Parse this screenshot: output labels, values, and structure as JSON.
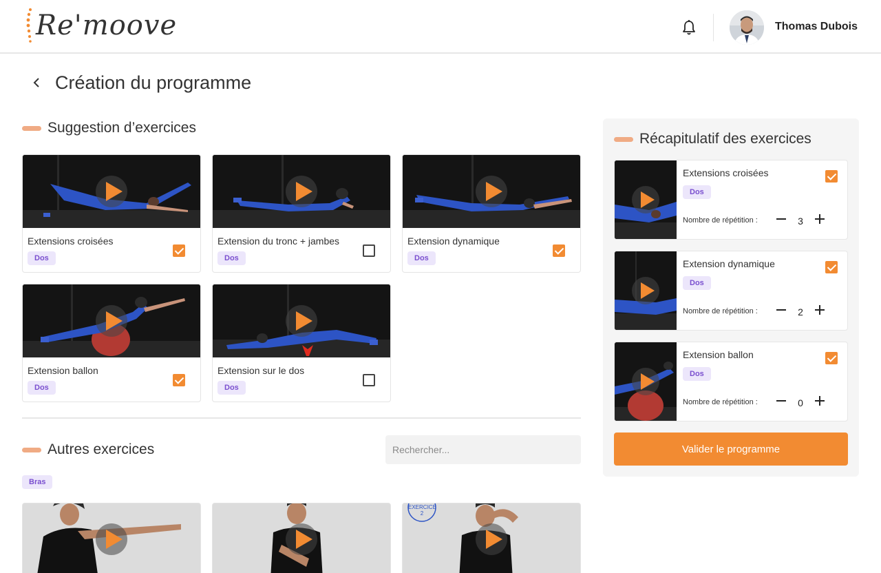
{
  "brand": {
    "logo_text": "Re'moove",
    "accent": "#f28b32",
    "tag_color": "#7a4fcf",
    "tag_bg": "#ece6fb"
  },
  "header": {
    "user_name": "Thomas Dubois",
    "bell_icon": "bell-icon",
    "avatar_icon": "user-avatar"
  },
  "page": {
    "title": "Création du programme",
    "back_icon": "chevron-left-icon"
  },
  "suggestions": {
    "title": "Suggestion d’exercices",
    "items": [
      {
        "title": "Extensions croisées",
        "tag": "Dos",
        "checked": true
      },
      {
        "title": "Extension du tronc + jambes",
        "tag": "Dos",
        "checked": false
      },
      {
        "title": "Extension dynamique",
        "tag": "Dos",
        "checked": true
      },
      {
        "title": "Extension ballon",
        "tag": "Dos",
        "checked": true
      },
      {
        "title": "Extension sur le dos",
        "tag": "Dos",
        "checked": false
      }
    ]
  },
  "others": {
    "title": "Autres exercices",
    "search_placeholder": "Rechercher...",
    "category": "Bras",
    "watermark": "EXERCICE 2"
  },
  "recap": {
    "title": "Récapitulatif des exercices",
    "reps_label": "Nombre de répétition :",
    "items": [
      {
        "title": "Extensions croisées",
        "tag": "Dos",
        "checked": true,
        "reps": "3"
      },
      {
        "title": "Extension dynamique",
        "tag": "Dos",
        "checked": true,
        "reps": "2"
      },
      {
        "title": "Extension ballon",
        "tag": "Dos",
        "checked": true,
        "reps": "0"
      }
    ],
    "validate_label": "Valider le programme"
  }
}
